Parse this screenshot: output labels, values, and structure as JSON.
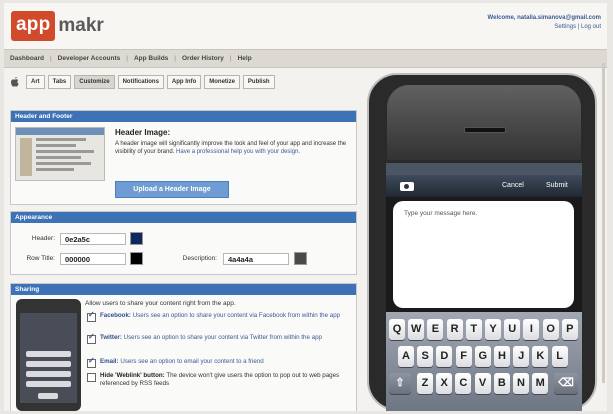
{
  "brand": {
    "logo_box": "app",
    "logo_rest": "makr"
  },
  "account": {
    "welcome": "Welcome, natalia.simanova@gmail.com",
    "links": "Settings | Log out"
  },
  "nav": {
    "items": [
      "Dashboard",
      "Developer Accounts",
      "App Builds",
      "Order History",
      "Help"
    ]
  },
  "steps": {
    "items": [
      "Art",
      "Tabs",
      "Customize",
      "Notifications",
      "App Info",
      "Monetize",
      "Publish"
    ],
    "active": "Customize"
  },
  "header_footer": {
    "title": "Header and Footer",
    "image_title": "Header Image:",
    "description": "A header image will significantly improve the look and feel of your app and increase the visibility of your brand.",
    "help_link": "Have a professional help you with your design.",
    "upload_label": "Upload a Header Image"
  },
  "appearance": {
    "title": "Appearance",
    "header_label": "Header:",
    "header_value": "0e2a5c",
    "header_color": "#0e2a5c",
    "row_title_label": "Row Title:",
    "row_title_value": "000000",
    "row_title_color": "#000000",
    "description_label": "Description:",
    "description_value": "4a4a4a",
    "description_color": "#4a4a4a"
  },
  "sharing": {
    "title": "Sharing",
    "intro": "Allow users to share your content right from the app.",
    "options": [
      {
        "name": "Facebook:",
        "text": "Users see an option to share your content via Facebook from within the app",
        "checked": true
      },
      {
        "name": "Twitter:",
        "text": "Users see an option to share your content via Twitter from within the app",
        "checked": true
      },
      {
        "name": "Email:",
        "text": "Users see an option to email your content to a friend",
        "checked": true
      },
      {
        "name": "Hide 'Weblink' button:",
        "text": "The device won't give users the option to pop out to web pages referenced by RSS feeds",
        "checked": false
      }
    ]
  },
  "phone": {
    "cancel": "Cancel",
    "submit": "Submit",
    "placeholder": "Type your message here.",
    "keys_row1": [
      "Q",
      "W",
      "E",
      "R",
      "T",
      "Y",
      "U",
      "I",
      "O",
      "P"
    ],
    "keys_row2": [
      "A",
      "S",
      "D",
      "F",
      "G",
      "H",
      "J",
      "K",
      "L"
    ],
    "keys_row3": [
      "Z",
      "X",
      "C",
      "V",
      "B",
      "N",
      "M"
    ],
    "shift_icon": "shift-icon",
    "backspace_icon": "backspace-icon"
  },
  "colors": {
    "panel_head": "#3d72b6",
    "logo": "#d24a2c",
    "upload_button": "#6f9dd3"
  }
}
